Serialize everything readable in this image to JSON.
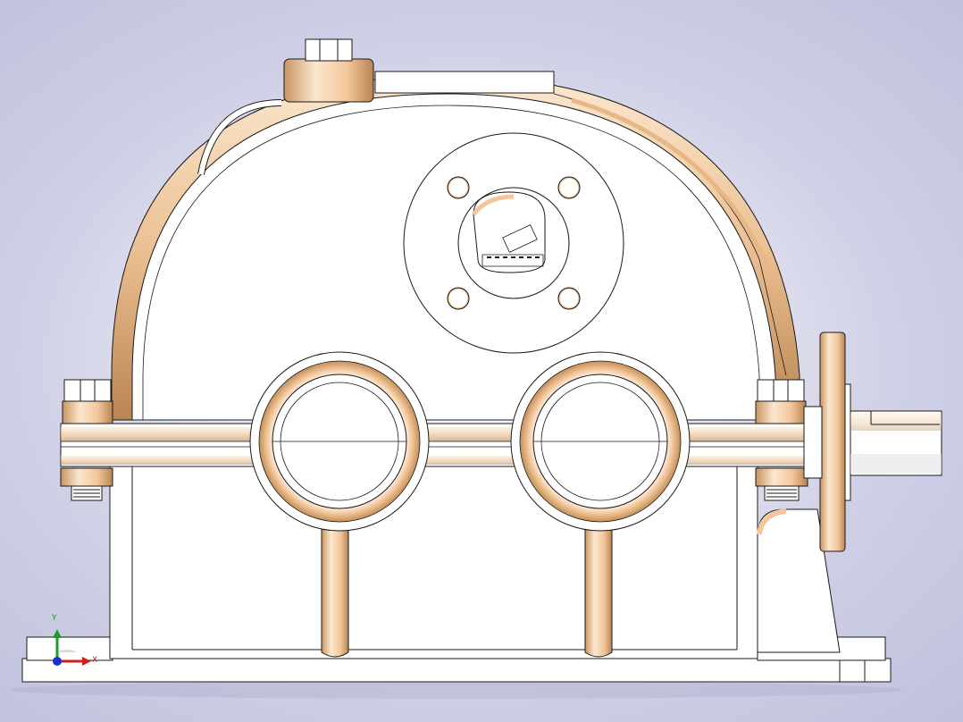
{
  "viewport": {
    "background_inner": "#ffffff",
    "background_outer": "#bfc0dd"
  },
  "model": {
    "body_color": "#ffffff",
    "edge_color": "#1a1a1a",
    "highlight_color": "#f3c79b",
    "shadow_color": "#b98552"
  },
  "triad": {
    "x_label": "X",
    "y_label": "Y",
    "x_color": "#d0201a",
    "y_color": "#1f9a2a",
    "z_color": "#1a2fd0"
  }
}
